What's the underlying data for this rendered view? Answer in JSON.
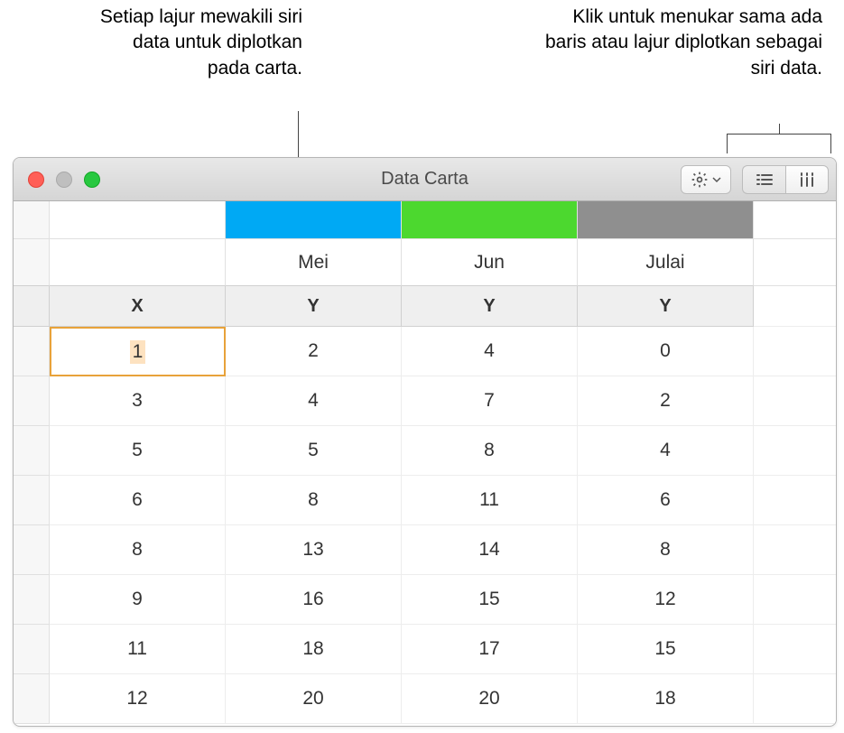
{
  "callouts": {
    "left": "Setiap lajur mewakili siri data untuk diplotkan pada carta.",
    "right": "Klik untuk menukar sama ada baris atau lajur diplotkan sebagai siri data."
  },
  "window": {
    "title": "Data Carta"
  },
  "columns": {
    "colors": [
      "#00a9f4",
      "#4cd82f",
      "#8f8f8f"
    ],
    "months": [
      "Mei",
      "Jun",
      "Julai"
    ],
    "axis_x": "X",
    "axis_y": "Y"
  },
  "rows": [
    {
      "x": "1",
      "y": [
        "2",
        "4",
        "0"
      ]
    },
    {
      "x": "3",
      "y": [
        "4",
        "7",
        "2"
      ]
    },
    {
      "x": "5",
      "y": [
        "5",
        "8",
        "4"
      ]
    },
    {
      "x": "6",
      "y": [
        "8",
        "11",
        "6"
      ]
    },
    {
      "x": "8",
      "y": [
        "13",
        "14",
        "8"
      ]
    },
    {
      "x": "9",
      "y": [
        "16",
        "15",
        "12"
      ]
    },
    {
      "x": "11",
      "y": [
        "18",
        "17",
        "15"
      ]
    },
    {
      "x": "12",
      "y": [
        "20",
        "20",
        "18"
      ]
    }
  ],
  "chart_data": {
    "type": "line",
    "x": [
      1,
      3,
      5,
      6,
      8,
      9,
      11,
      12
    ],
    "series": [
      {
        "name": "Mei",
        "color": "#00a9f4",
        "values": [
          2,
          4,
          5,
          8,
          13,
          16,
          18,
          20
        ]
      },
      {
        "name": "Jun",
        "color": "#4cd82f",
        "values": [
          4,
          7,
          8,
          11,
          14,
          15,
          17,
          20
        ]
      },
      {
        "name": "Julai",
        "color": "#8f8f8f",
        "values": [
          0,
          2,
          4,
          6,
          8,
          12,
          15,
          18
        ]
      }
    ],
    "xlabel": "X",
    "ylabel": "Y"
  }
}
